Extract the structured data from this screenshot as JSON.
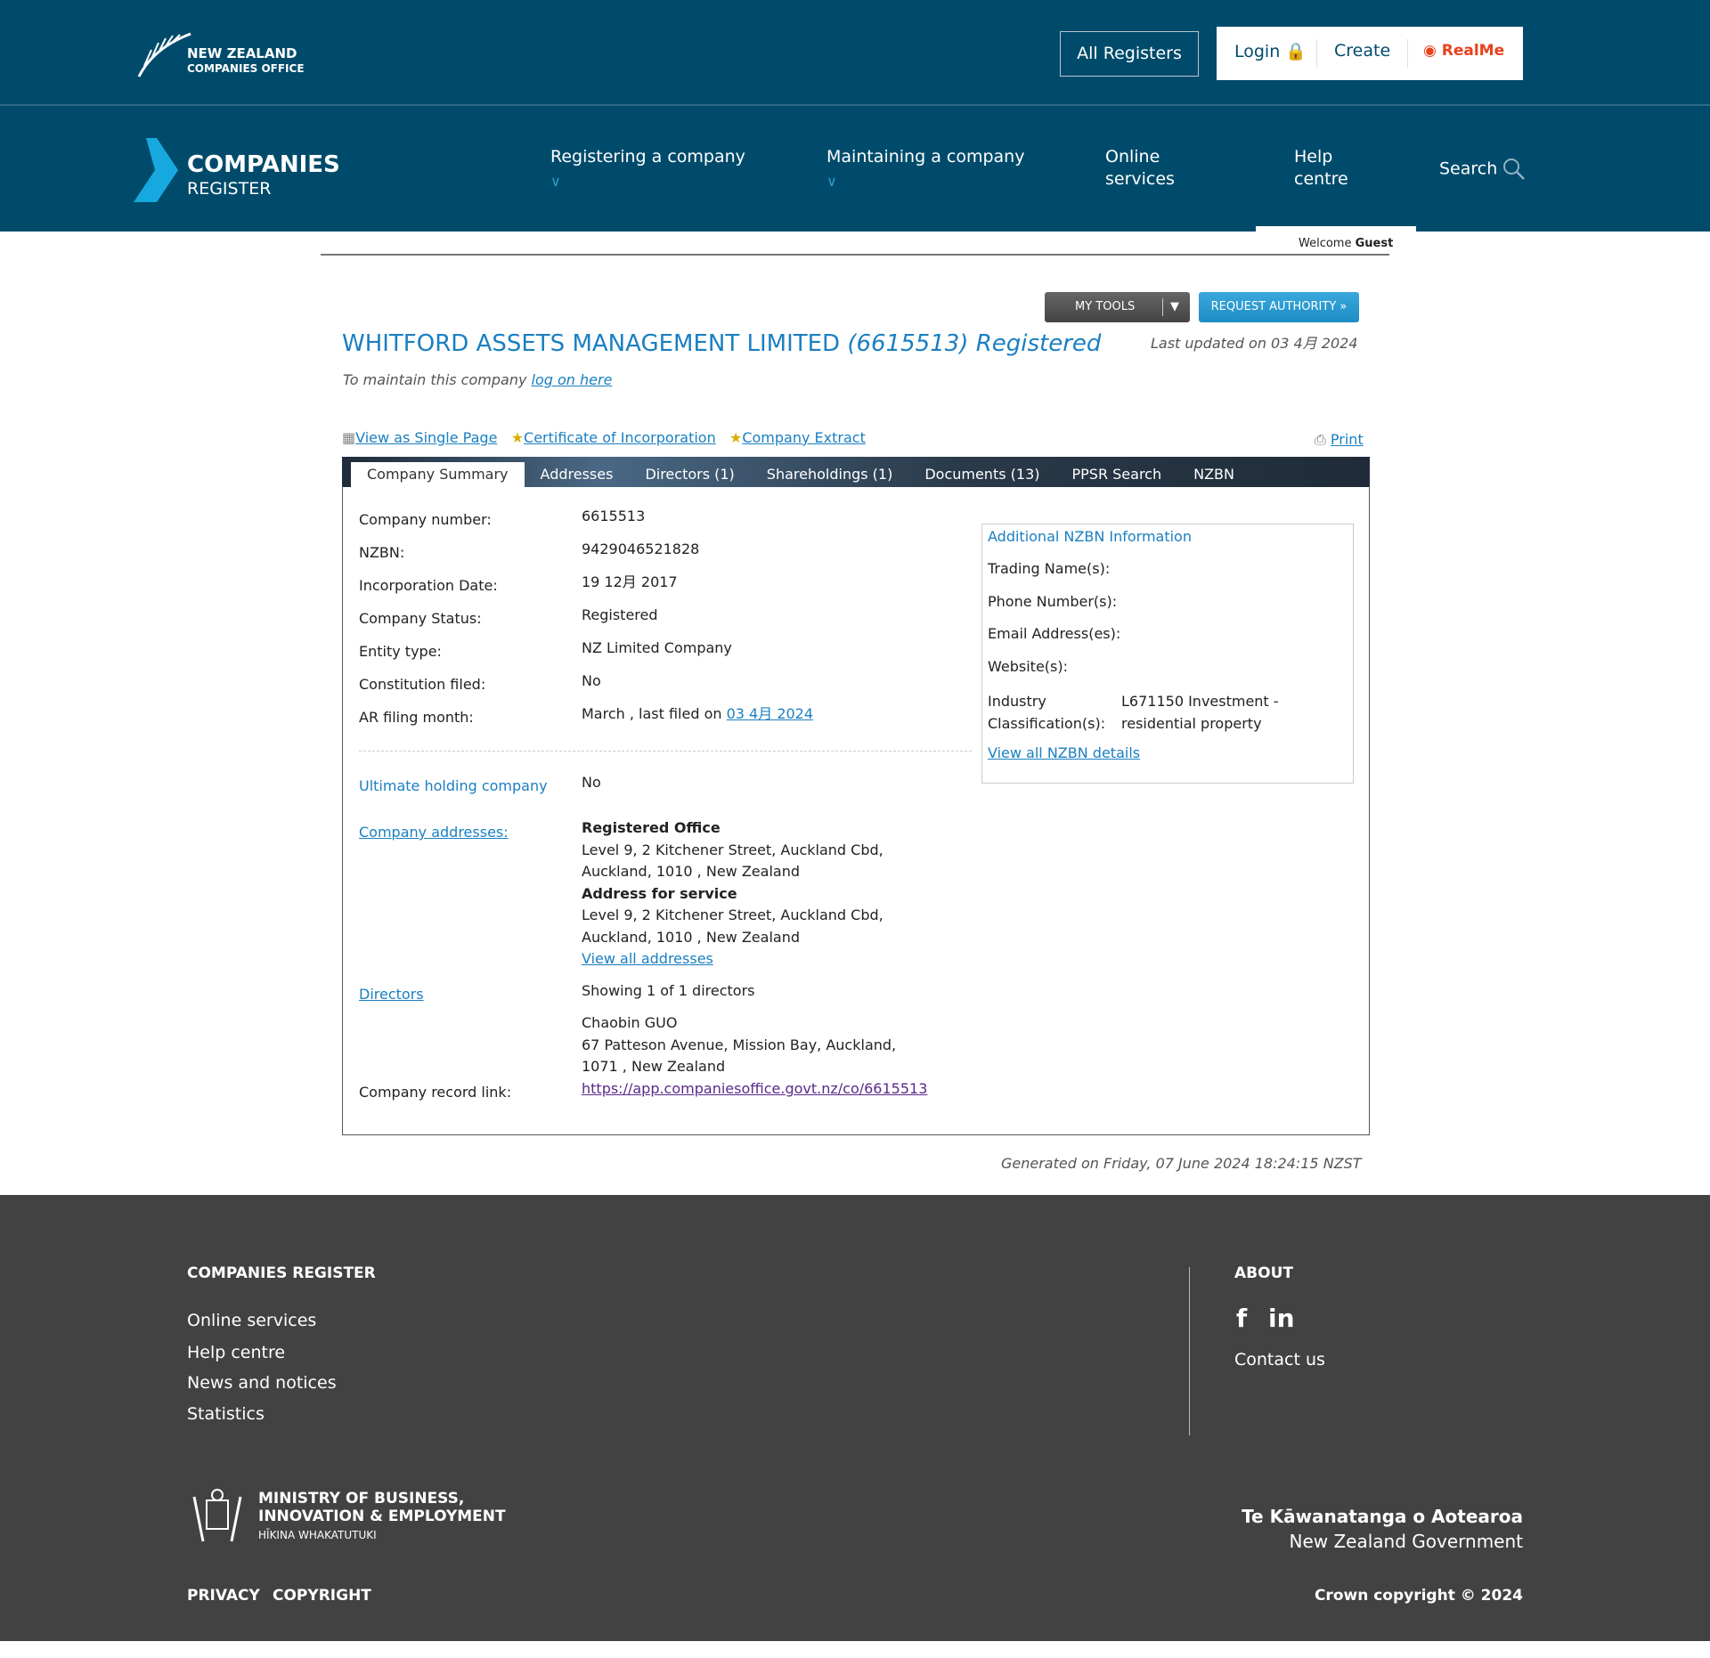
{
  "header": {
    "logo": "NEW ZEALAND COMPANIES OFFICE",
    "logo_line1": "NEW ZEALAND",
    "logo_line2": "COMPANIES OFFICE",
    "all_registers": "All Registers",
    "login": "Login",
    "create": "Create",
    "realme": "RealMe"
  },
  "nav": {
    "brand1": "COMPANIES",
    "brand2": "REGISTER",
    "items": [
      {
        "label": "Registering a company"
      },
      {
        "label": "Maintaining a company"
      },
      {
        "label1": "Online",
        "label2": "services"
      },
      {
        "label1": "Help",
        "label2": "centre"
      }
    ],
    "search": "Search",
    "welcome": "Welcome",
    "user": "Guest"
  },
  "toolbar": {
    "my_tools": "MY TOOLS",
    "request_authority": "REQUEST AUTHORITY »"
  },
  "company": {
    "name": "WHITFORD ASSETS MANAGEMENT LIMITED",
    "number_status": "(6615513) Registered",
    "last_updated": "Last updated on 03 4月 2024",
    "maintain_text": "To maintain this company",
    "log_on": "log on here"
  },
  "links": {
    "single_page": "View as Single Page",
    "certificate": "Certificate of Incorporation",
    "extract": "Company Extract",
    "print": "Print"
  },
  "tabs": [
    "Company Summary",
    "Addresses",
    "Directors (1)",
    "Shareholdings (1)",
    "Documents (13)",
    "PPSR Search",
    "NZBN"
  ],
  "summary": {
    "rows": [
      {
        "label": "Company number:",
        "value": "6615513"
      },
      {
        "label": "NZBN:",
        "value": "9429046521828"
      },
      {
        "label": "Incorporation Date:",
        "value": "19 12月 2017"
      },
      {
        "label": "Company Status:",
        "value": "Registered"
      },
      {
        "label": "Entity type:",
        "value": "NZ Limited Company"
      },
      {
        "label": "Constitution filed:",
        "value": "No"
      },
      {
        "label": "AR filing month:",
        "value": "March , last filed on",
        "link": "03 4月 2024"
      }
    ],
    "ultimate_label": "Ultimate holding company",
    "ultimate_value": "No",
    "addresses_label": "Company addresses:",
    "reg_office_title": "Registered Office",
    "reg_office_1": "Level 9, 2 Kitchener Street, Auckland Cbd,",
    "reg_office_2": "Auckland, 1010 , New Zealand",
    "service_title": "Address for service",
    "service_1": "Level 9, 2 Kitchener Street, Auckland Cbd,",
    "service_2": "Auckland, 1010 , New Zealand",
    "view_addresses": "View all addresses",
    "directors_label": "Directors",
    "directors_showing": "Showing 1 of 1 directors",
    "director_name": "Chaobin GUO",
    "director_addr1": "67 Patteson Avenue, Mission Bay, Auckland,",
    "director_addr2": "1071 , New Zealand",
    "record_label": "Company record link:",
    "record_link": "https://app.companiesoffice.govt.nz/co/6615513"
  },
  "nzbn": {
    "title": "Additional NZBN Information",
    "trading": "Trading Name(s):",
    "phone": "Phone Number(s):",
    "email": "Email Address(es):",
    "website": "Website(s):",
    "industry1": "Industry",
    "industry2": "Classification(s):",
    "industry_val1": "L671150 Investment -",
    "industry_val2": "residential property",
    "view_all": "View all NZBN details"
  },
  "generated": "Generated on Friday, 07 June 2024 18:24:15 NZST",
  "footer": {
    "heading": "COMPANIES REGISTER",
    "links": [
      "Online services",
      "Help centre",
      "News and notices",
      "Statistics"
    ],
    "about": "ABOUT",
    "contact": "Contact us",
    "mbie1": "MINISTRY OF BUSINESS,",
    "mbie2": "INNOVATION & EMPLOYMENT",
    "mbie3": "HĪKINA WHAKATUTUKI",
    "gov1": "Te Kāwanatanga o Aotearoa",
    "gov2": "New Zealand Government",
    "privacy": "PRIVACY",
    "copyright": "COPYRIGHT",
    "crown": "Crown copyright © 2024"
  },
  "colors": {
    "header_bg": "#004b6b",
    "title_blue": "#1a7fc1",
    "footer_bg": "#424242",
    "tab_bar": "#2a3a4a",
    "request_btn": "#2a9ad0",
    "realme_red": "#e8411c"
  }
}
